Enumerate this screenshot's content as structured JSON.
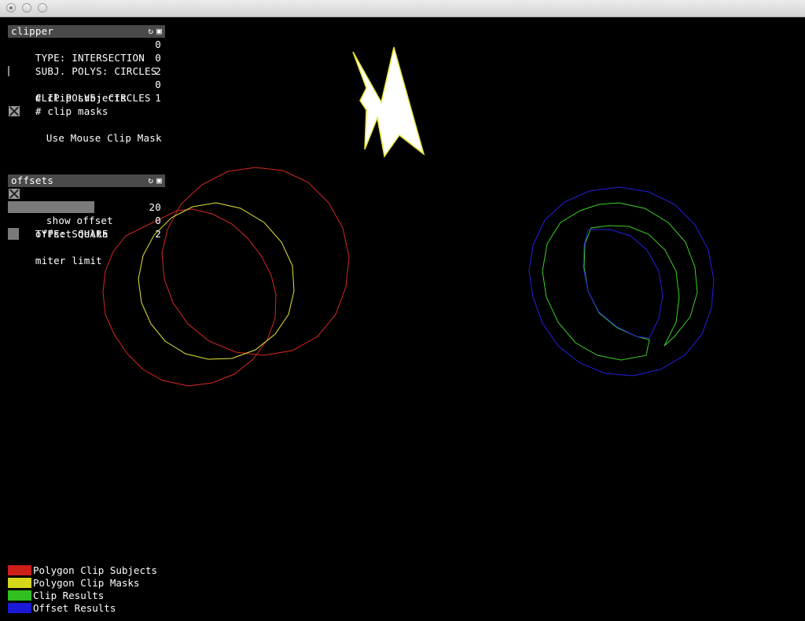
{
  "window": {
    "buttons": [
      "close",
      "minimize",
      "maximize"
    ]
  },
  "clipper_panel": {
    "title": "clipper",
    "rows": [
      {
        "label": "TYPE: INTERSECTION",
        "value": "0"
      },
      {
        "label": "SUBJ. POLYS: CIRCLES",
        "value": "0"
      },
      {
        "label": "# clip subjects",
        "value": "2"
      },
      {
        "label": "CLIP POLYS: CIRCLES",
        "value": "0"
      },
      {
        "label": "# clip masks",
        "value": "1"
      }
    ],
    "toggle_label": "Use Mouse Clip Mask",
    "toggle_checked": true
  },
  "offsets_panel": {
    "title": "offsets",
    "toggle_label": "show offset",
    "toggle_checked": true,
    "offset_delta": {
      "label": "offset delta",
      "value": "20",
      "fill_fraction": 0.55
    },
    "type": {
      "label": "TYPE: SQUARE",
      "value": "0"
    },
    "miter_limit": {
      "label": "miter limit",
      "value": "2",
      "fill_fraction": 0.07
    }
  },
  "legend": [
    {
      "label": "Polygon Clip Subjects",
      "color": "#cc1f1a"
    },
    {
      "label": "Polygon Clip Masks",
      "color": "#d6d61c"
    },
    {
      "label": "Clip Results",
      "color": "#2fbf1f"
    },
    {
      "label": "Offset Results",
      "color": "#1a1ad6"
    }
  ],
  "colors": {
    "subjects": "#d42a1f",
    "masks": "#e4e43a",
    "clip_results": "#3ecf2a",
    "offset_results": "#2222e0",
    "background": "#000000"
  }
}
